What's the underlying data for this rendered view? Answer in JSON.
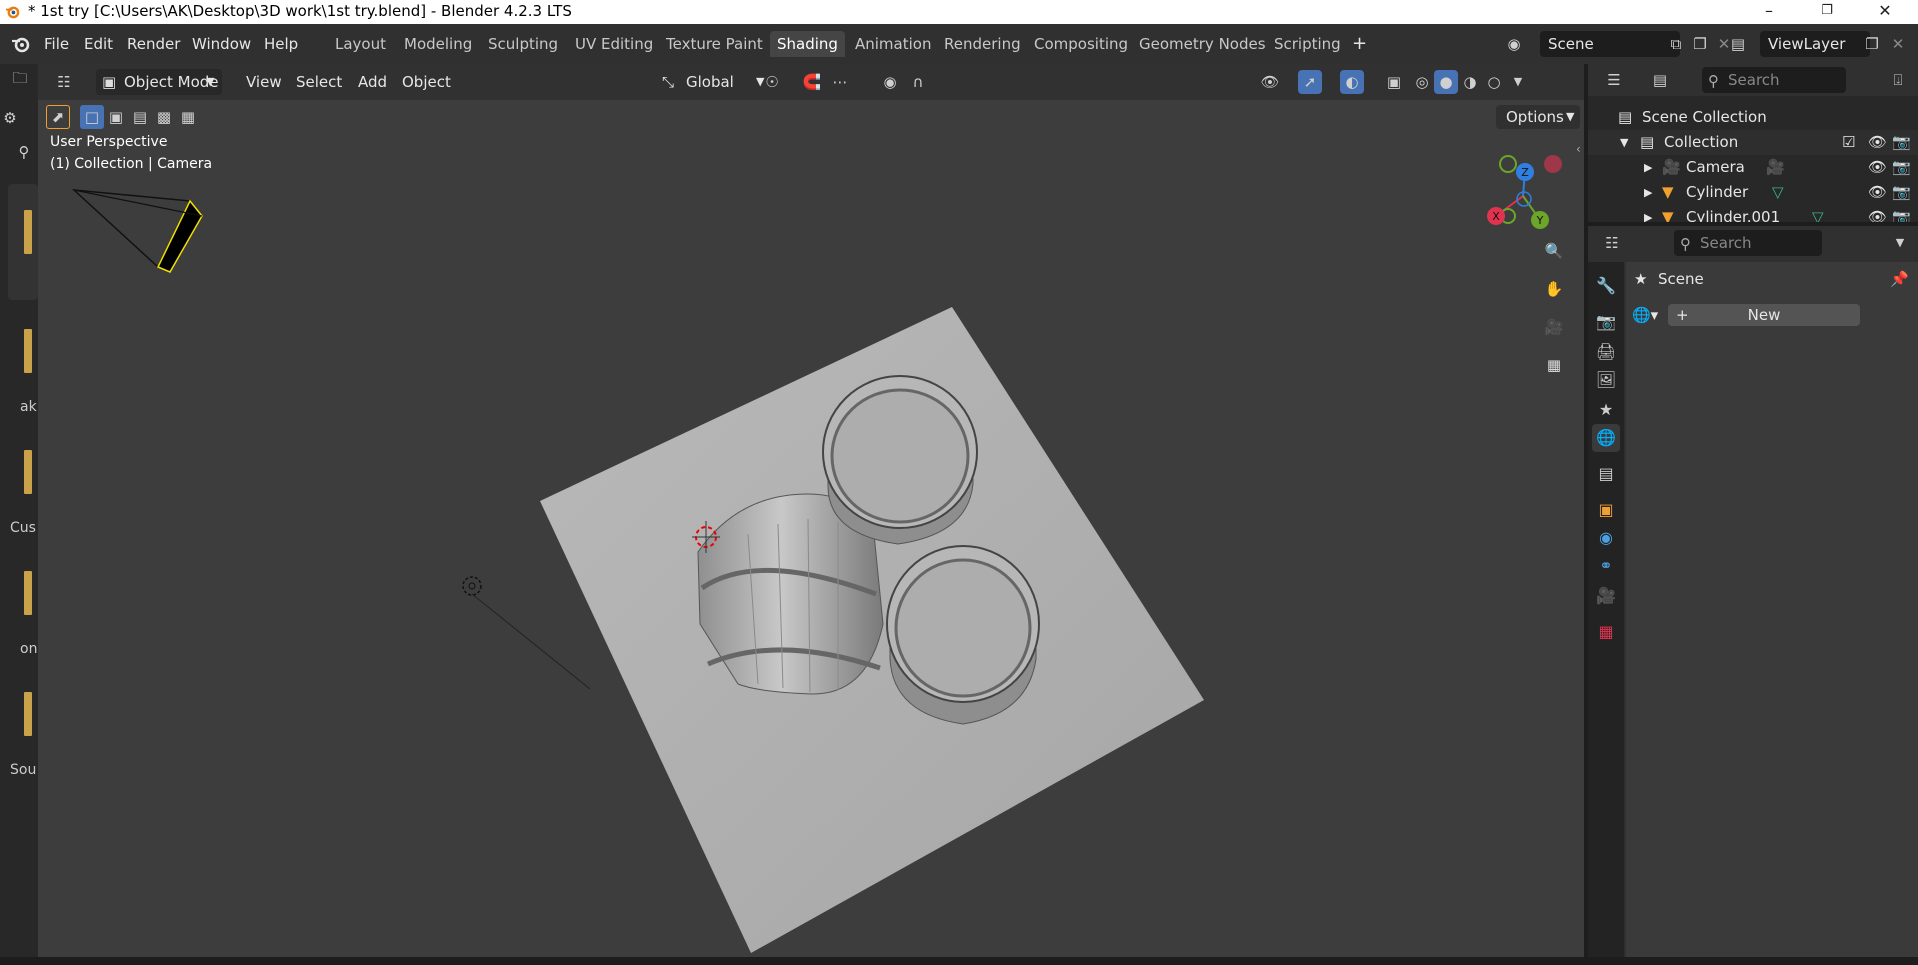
{
  "window": {
    "title": "* 1st try [C:\\Users\\AK\\Desktop\\3D work\\1st try.blend] - Blender 4.2.3 LTS",
    "controls": [
      "–",
      "❐",
      "✕"
    ]
  },
  "menu": [
    "File",
    "Edit",
    "Render",
    "Window",
    "Help"
  ],
  "workspaces": [
    {
      "label": "Layout",
      "active": false
    },
    {
      "label": "Modeling",
      "active": false
    },
    {
      "label": "Sculpting",
      "active": false
    },
    {
      "label": "UV Editing",
      "active": false
    },
    {
      "label": "Texture Paint",
      "active": false
    },
    {
      "label": "Shading",
      "active": true
    },
    {
      "label": "Animation",
      "active": false
    },
    {
      "label": "Rendering",
      "active": false
    },
    {
      "label": "Compositing",
      "active": false
    },
    {
      "label": "Geometry Nodes",
      "active": false
    },
    {
      "label": "Scripting",
      "active": false
    }
  ],
  "add_workspace": "+",
  "scene_field": "Scene",
  "viewlayer_field": "ViewLayer",
  "viewport": {
    "mode": "Object Mode",
    "menus": [
      "View",
      "Select",
      "Add",
      "Object"
    ],
    "transform_orientation": "Global",
    "options_label": "Options",
    "perspective_label": "User Perspective",
    "collection_label": "(1) Collection | Camera",
    "axes": {
      "x": "X",
      "y": "Y",
      "z": "Z"
    }
  },
  "left_strip_labels": [
    "ak",
    "Cus",
    "on",
    "Sou"
  ],
  "outliner": {
    "search_placeholder": "Search",
    "scene_collection": "Scene Collection",
    "collection": "Collection",
    "items": [
      "Camera",
      "Cylinder",
      "Cylinder.001"
    ]
  },
  "properties": {
    "search_placeholder": "Search",
    "scene_label": "Scene",
    "new_button": "New"
  },
  "colors": {
    "accent_blue": "#4772b3",
    "axis_x": "#e0334f",
    "axis_y": "#6ba52a",
    "axis_z": "#2f7fe0",
    "selection_orange": "#f0a030"
  }
}
